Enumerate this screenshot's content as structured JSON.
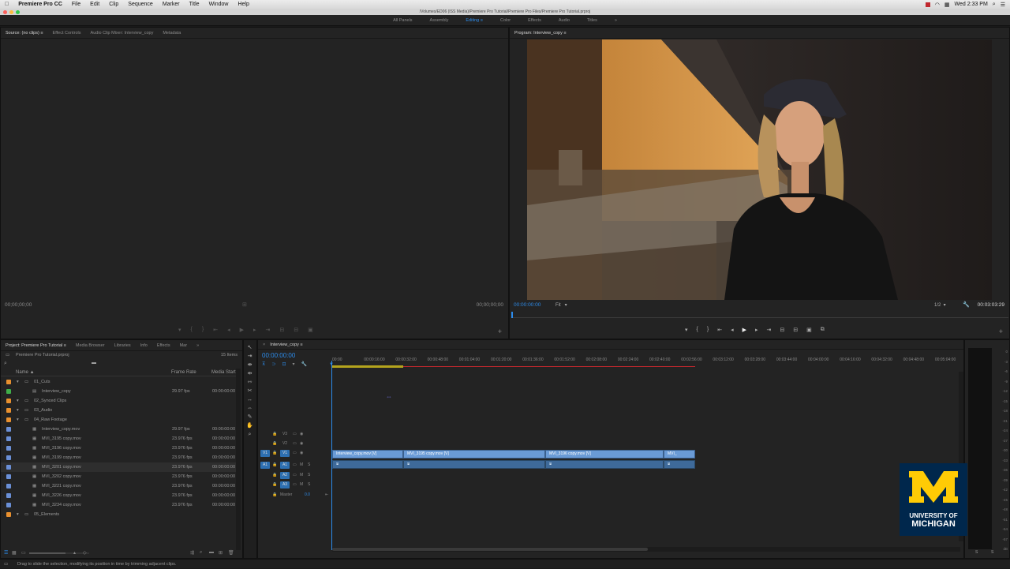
{
  "menubar": {
    "app": "Premiere Pro CC",
    "items": [
      "File",
      "Edit",
      "Clip",
      "Sequence",
      "Marker",
      "Title",
      "Window",
      "Help"
    ],
    "clock": "Wed 2:33 PM"
  },
  "titlebar": {
    "path": "/Volumes/ED06 (ISS Media)/Premiere Pro Tutorial/Premiere Pro Files/Premiere Pro Tutorial.prproj"
  },
  "workspaces": {
    "items": [
      "All Panels",
      "Assembly",
      "Editing",
      "Color",
      "Effects",
      "Audio",
      "Titles"
    ],
    "active": "Editing",
    "more": "»"
  },
  "source": {
    "tabs": [
      "Source: (no clips)",
      "Effect Controls",
      "Audio Clip Mixer: Interview_copy",
      "Metadata"
    ],
    "tc_left": "00;00;00;00",
    "tc_right": "00;00;00;00"
  },
  "program": {
    "tab": "Program: Interview_copy",
    "tc_current": "00:00:00:00",
    "fit": "Fit",
    "resolution": "1/2",
    "tc_duration": "00:03:03:29"
  },
  "project": {
    "tabs": [
      "Project: Premiere Pro Tutorial",
      "Media Browser",
      "Libraries",
      "Info",
      "Effects",
      "Mar"
    ],
    "more": "»",
    "file": "Premiere Pro Tutorial.prproj",
    "count": "15 Items",
    "columns": {
      "name": "Name",
      "frame_rate": "Frame Rate",
      "media_start": "Media Start"
    },
    "rows": [
      {
        "name": "01_Cuts",
        "fps": "",
        "start": "",
        "indent": 1,
        "type": "bin",
        "color": "#e8902f"
      },
      {
        "name": "Interview_copy",
        "fps": "29.97 fps",
        "start": "00:00:00:00",
        "indent": 2,
        "type": "seq",
        "color": "#3fae49"
      },
      {
        "name": "02_Synced Clips",
        "fps": "",
        "start": "",
        "indent": 1,
        "type": "bin",
        "color": "#e8902f"
      },
      {
        "name": "03_Audio",
        "fps": "",
        "start": "",
        "indent": 1,
        "type": "bin",
        "color": "#e8902f"
      },
      {
        "name": "04_Raw Footage",
        "fps": "",
        "start": "",
        "indent": 1,
        "type": "bin",
        "color": "#e8902f"
      },
      {
        "name": "Interview_copy.mov",
        "fps": "29.97 fps",
        "start": "00:00:00:00",
        "indent": 2,
        "type": "clip",
        "color": "#6a8fd6"
      },
      {
        "name": "MVI_3195 copy.mov",
        "fps": "23.976 fps",
        "start": "00:00:00:00",
        "indent": 2,
        "type": "clip",
        "color": "#6a8fd6"
      },
      {
        "name": "MVI_3196 copy.mov",
        "fps": "23.976 fps",
        "start": "00:00:00:00",
        "indent": 2,
        "type": "clip",
        "color": "#6a8fd6"
      },
      {
        "name": "MVI_3199 copy.mov",
        "fps": "23.976 fps",
        "start": "00:00:00:00",
        "indent": 2,
        "type": "clip",
        "color": "#6a8fd6"
      },
      {
        "name": "MVI_3201 copy.mov",
        "fps": "23.976 fps",
        "start": "00:00:00:00",
        "indent": 2,
        "type": "clip",
        "color": "#6a8fd6",
        "selected": true
      },
      {
        "name": "MVI_3202 copy.mov",
        "fps": "23.976 fps",
        "start": "00:00:00:00",
        "indent": 2,
        "type": "clip",
        "color": "#6a8fd6"
      },
      {
        "name": "MVI_3221 copy.mov",
        "fps": "23.976 fps",
        "start": "00:00:00:00",
        "indent": 2,
        "type": "clip",
        "color": "#6a8fd6"
      },
      {
        "name": "MVI_3226 copy.mov",
        "fps": "23.976 fps",
        "start": "00:00:00:00",
        "indent": 2,
        "type": "clip",
        "color": "#6a8fd6"
      },
      {
        "name": "MVI_3234 copy.mov",
        "fps": "23.976 fps",
        "start": "00:00:00:00",
        "indent": 2,
        "type": "clip",
        "color": "#6a8fd6"
      },
      {
        "name": "05_Elements",
        "fps": "",
        "start": "",
        "indent": 1,
        "type": "bin",
        "color": "#e8902f"
      }
    ]
  },
  "timeline": {
    "tab": "Interview_copy",
    "tc": "00:00:00:00",
    "ruler": [
      "00:00",
      "00:00:16:00",
      "00:00:32:00",
      "00:00:48:00",
      "00:01:04:00",
      "00:01:20:00",
      "00:01:36:00",
      "00:01:52:00",
      "00:02:08:00",
      "00:02:24:00",
      "00:02:40:00",
      "00:02:56:00",
      "00:03:12:00",
      "00:03:28:00",
      "00:03:44:00",
      "00:04:00:00",
      "00:04:16:00",
      "00:04:32:00",
      "00:04:48:00",
      "00:05:04:00",
      "00:0"
    ],
    "video_tracks": [
      "V3",
      "V2",
      "V1"
    ],
    "audio_tracks": [
      "A1",
      "A2",
      "A3"
    ],
    "src_v": "V1",
    "src_a": "A1",
    "master": "Master",
    "master_val": "0.0",
    "clips": [
      {
        "label": "Interview_copy.mov [V]"
      },
      {
        "label": "MVI_3195 copy.mov [V]"
      },
      {
        "label": "MVI_3196 copy.mov [V]"
      },
      {
        "label": "MVI_"
      }
    ]
  },
  "meter": {
    "labels": [
      "0",
      "-3",
      "-6",
      "-9",
      "-12",
      "-15",
      "-18",
      "-21",
      "-24",
      "-27",
      "-30",
      "-33",
      "-36",
      "-39",
      "-42",
      "-45",
      "-48",
      "-51",
      "-54",
      "-57",
      "dB"
    ],
    "bottom": [
      "S",
      "S"
    ]
  },
  "logo": {
    "letter": "M",
    "line1": "UNIVERSITY OF",
    "line2": "MICHIGAN",
    "color": "#ffcb05",
    "bg": "#00274c"
  },
  "status": {
    "text": "Drag to slide the selection, modifying its position in time by trimming adjacent clips."
  }
}
